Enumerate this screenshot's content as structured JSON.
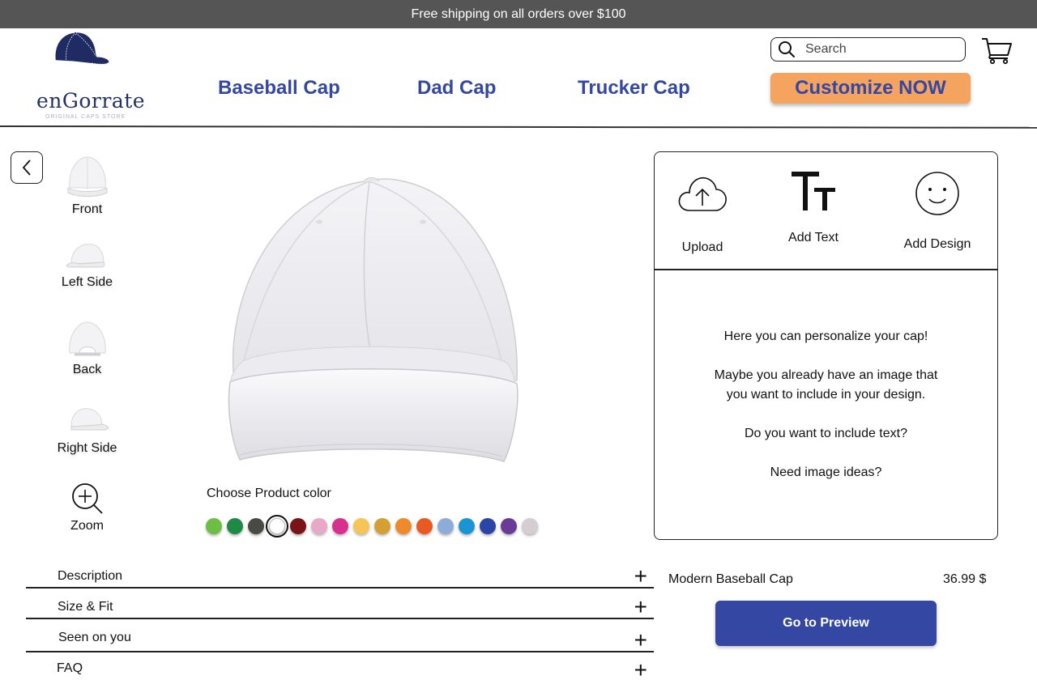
{
  "promo": {
    "text": "Free shipping on all orders over $100"
  },
  "brand": {
    "name": "enGorrate",
    "tagline": "ORIGINAL CAPS STORE"
  },
  "nav": {
    "items": [
      {
        "label": "Baseball Cap"
      },
      {
        "label": "Dad Cap"
      },
      {
        "label": "Trucker Cap"
      }
    ],
    "cta_label": "Customize NOW"
  },
  "search": {
    "placeholder": "Search"
  },
  "views": [
    {
      "label": "Front"
    },
    {
      "label": "Left Side"
    },
    {
      "label": "Back"
    },
    {
      "label": "Right Side"
    }
  ],
  "zoom": {
    "label": "Zoom"
  },
  "color_picker": {
    "label": "Choose Product color",
    "colors": [
      "#6cbe45",
      "#1e8a45",
      "#4a4a44",
      "#ffffff",
      "#7a1418",
      "#e8a9c8",
      "#d8308e",
      "#f7c458",
      "#d4a033",
      "#ee8a2c",
      "#e85a22",
      "#8eacd9",
      "#1c94d4",
      "#2b44a5",
      "#6b3c97",
      "#d6cdd2"
    ],
    "selected_index": 3
  },
  "tools": [
    {
      "label": "Upload",
      "icon": "cloud-upload-icon"
    },
    {
      "label": "Add Text",
      "icon": "text-size-icon"
    },
    {
      "label": "Add Design",
      "icon": "smiley-icon"
    }
  ],
  "panel_messages": [
    "Here you can personalize your cap!",
    "Maybe you already have an image that you want to include in your design.",
    "Do you want to include text?",
    "Need image ideas?"
  ],
  "product": {
    "name": "Modern Baseball Cap",
    "price": "36.99 $"
  },
  "preview_button": "Go to Preview",
  "accordion": [
    {
      "label": "Description"
    },
    {
      "label": "Size & Fit"
    },
    {
      "label": "Seen on you"
    },
    {
      "label": "FAQ"
    }
  ]
}
